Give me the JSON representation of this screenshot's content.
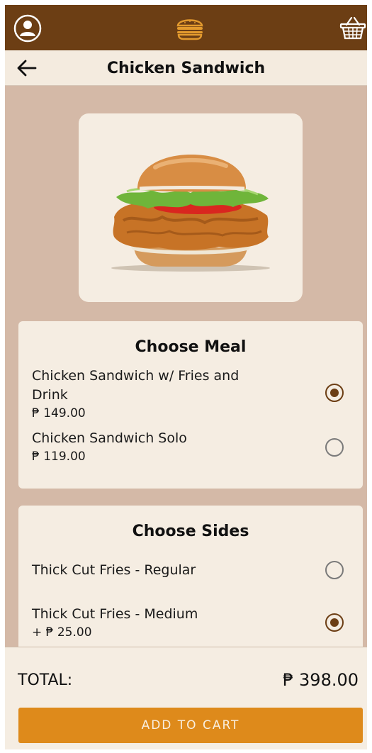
{
  "colors": {
    "topbar": "#6c3e14",
    "background": "#d4b9a7",
    "card": "#f5ede2",
    "accent": "#de8a1b",
    "radio_selected": "#6c3e14"
  },
  "header": {
    "title": "Chicken Sandwich",
    "icons": [
      "profile-icon",
      "burger-logo-icon",
      "cart-basket-icon",
      "back-arrow-icon"
    ]
  },
  "meal": {
    "title": "Choose Meal",
    "options": [
      {
        "name_line1": "Chicken Sandwich w/ Fries and",
        "name_line2": "Drink",
        "price": "₱ 149.00",
        "selected": true
      },
      {
        "name": "Chicken Sandwich Solo",
        "price": "₱ 119.00",
        "selected": false
      }
    ]
  },
  "sides": {
    "title": "Choose Sides",
    "options": [
      {
        "name": "Thick Cut Fries - Regular",
        "price": "",
        "selected": false
      },
      {
        "name": "Thick Cut Fries - Medium",
        "price": "+ ₱ 25.00",
        "selected": true
      }
    ]
  },
  "footer": {
    "total_label": "TOTAL:",
    "total_value": "₱ 398.00",
    "add_button": "ADD TO CART"
  }
}
